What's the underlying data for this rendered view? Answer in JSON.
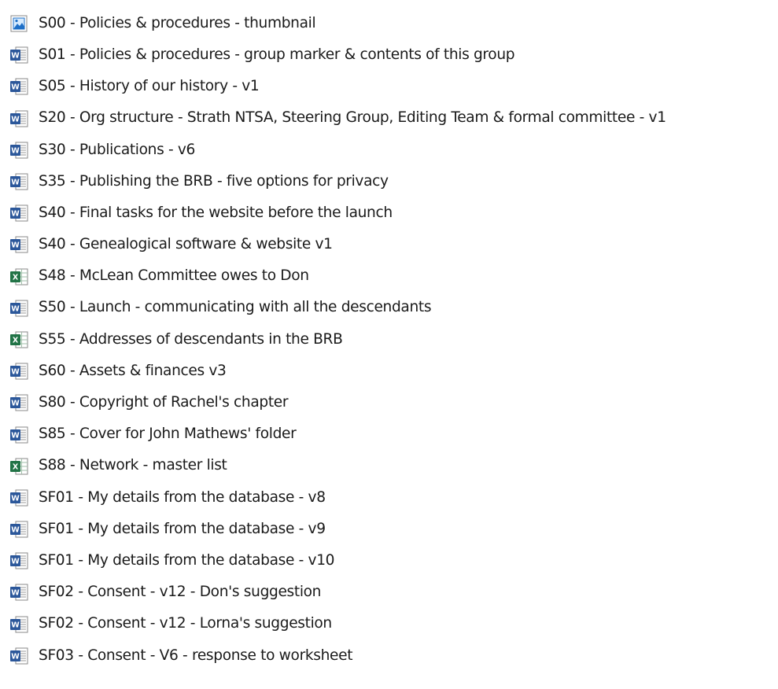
{
  "colors": {
    "text": "#1a1a1a",
    "word_icon": "#2b579a",
    "excel_icon": "#217346",
    "image_icon": "#1e6fc7"
  },
  "files": [
    {
      "name": "S00 - Policies & procedures - thumbnail",
      "icon": "image-file-icon"
    },
    {
      "name": "S01 - Policies & procedures - group marker & contents of this group",
      "icon": "word-document-icon"
    },
    {
      "name": "S05 - History of our history - v1",
      "icon": "word-document-icon"
    },
    {
      "name": "S20 - Org structure - Strath NTSA, Steering Group, Editing Team & formal committee - v1",
      "icon": "word-document-icon"
    },
    {
      "name": "S30 - Publications - v6",
      "icon": "word-document-icon"
    },
    {
      "name": "S35 - Publishing the BRB - five options for privacy",
      "icon": "word-document-icon"
    },
    {
      "name": "S40 - Final tasks for the website before the launch",
      "icon": "word-document-icon"
    },
    {
      "name": "S40 - Genealogical software & website v1",
      "icon": "word-document-icon"
    },
    {
      "name": "S48 - McLean Committee owes to Don",
      "icon": "excel-spreadsheet-icon"
    },
    {
      "name": "S50 - Launch - communicating with all the descendants",
      "icon": "word-document-icon"
    },
    {
      "name": "S55 - Addresses of descendants in the BRB",
      "icon": "excel-spreadsheet-icon"
    },
    {
      "name": "S60 - Assets & finances v3",
      "icon": "word-document-icon"
    },
    {
      "name": "S80 - Copyright of Rachel's chapter",
      "icon": "word-document-icon"
    },
    {
      "name": "S85 - Cover for John Mathews' folder",
      "icon": "word-document-icon"
    },
    {
      "name": "S88 - Network - master list",
      "icon": "excel-spreadsheet-icon"
    },
    {
      "name": "SF01 - My details from the database - v8",
      "icon": "word-document-icon"
    },
    {
      "name": "SF01 - My details from the database - v9",
      "icon": "word-document-icon"
    },
    {
      "name": "SF01 - My details from the database - v10",
      "icon": "word-document-icon"
    },
    {
      "name": "SF02 - Consent - v12 - Don's suggestion",
      "icon": "word-document-icon"
    },
    {
      "name": "SF02 - Consent - v12 - Lorna's suggestion",
      "icon": "word-document-icon"
    },
    {
      "name": "SF03 - Consent - V6 - response to worksheet",
      "icon": "word-document-icon"
    }
  ]
}
